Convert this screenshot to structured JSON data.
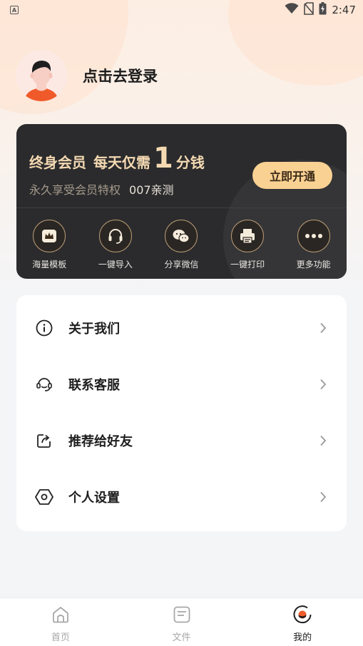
{
  "status_bar": {
    "time": "2:47",
    "left_badge": "A",
    "icons": [
      "wifi-icon",
      "no-sim-icon",
      "battery-charging-icon"
    ]
  },
  "profile": {
    "login_text": "点击去登录",
    "avatar_icon": "avatar-icon"
  },
  "vip": {
    "title_prefix": "终身会员",
    "title_mid": "每天仅需",
    "title_number": "1",
    "title_suffix": "分钱",
    "subtitle": "永久享受会员特权",
    "subtitle_highlight": "007亲测",
    "open_button": "立即开通",
    "features": [
      {
        "label": "海量模板",
        "icon": "crown-icon"
      },
      {
        "label": "一键导入",
        "icon": "headset-icon"
      },
      {
        "label": "分享微信",
        "icon": "wechat-icon"
      },
      {
        "label": "一键打印",
        "icon": "printer-icon"
      },
      {
        "label": "更多功能",
        "icon": "more-icon"
      }
    ]
  },
  "menu": {
    "items": [
      {
        "label": "关于我们",
        "icon": "info-icon"
      },
      {
        "label": "联系客服",
        "icon": "customer-service-icon"
      },
      {
        "label": "推荐给好友",
        "icon": "share-icon"
      },
      {
        "label": "个人设置",
        "icon": "settings-icon"
      }
    ]
  },
  "tabs": [
    {
      "label": "首页",
      "icon": "home-icon",
      "active": false
    },
    {
      "label": "文件",
      "icon": "file-icon",
      "active": false
    },
    {
      "label": "我的",
      "icon": "profile-icon",
      "active": true
    }
  ],
  "colors": {
    "vip_card_bg": "#2b2b2d",
    "vip_gold": "#f4d9b2",
    "open_button_bg": "#f9d193",
    "accent_orange": "#f05a2a"
  }
}
